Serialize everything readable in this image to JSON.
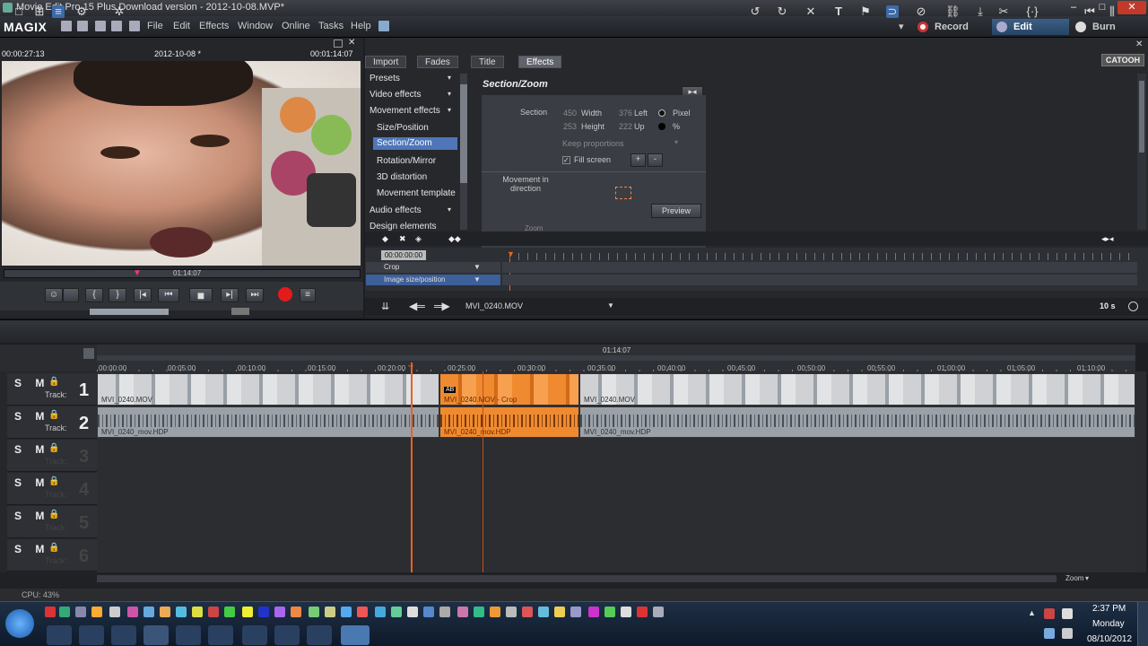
{
  "window": {
    "title": "Movie Edit Pro 15 Plus Download version - 2012-10-08.MVP*",
    "min": "–",
    "max": "□",
    "close": "✕"
  },
  "menubar": {
    "logo": "MAGIX",
    "items": [
      "File",
      "Edit",
      "Effects",
      "Window",
      "Online",
      "Tasks",
      "Help"
    ],
    "modes": [
      "Record",
      "Edit",
      "Burn"
    ]
  },
  "preview": {
    "timecode_left": "00:00:27:13",
    "project": "2012-10-08 *",
    "timecode_right": "00:01:14:07",
    "scrub_time": "01:14:07"
  },
  "effects": {
    "tabs": [
      "Import",
      "Fades",
      "Title",
      "Effects"
    ],
    "brand": "CATOOH",
    "tree": [
      "Presets",
      "Video effects",
      "Movement effects",
      "Size/Position",
      "Section/Zoom",
      "Rotation/Mirror",
      "3D distortion",
      "Movement template",
      "Audio effects",
      "Design elements"
    ],
    "panel_title": "Section/Zoom",
    "section_label": "Section",
    "width_value": "450",
    "width_label": "Width",
    "left_value": "376",
    "left_label": "Left",
    "height_value": "253",
    "height_label": "Height",
    "up_value": "222",
    "up_label": "Up",
    "unit_pixel": "Pixel",
    "unit_percent": "%",
    "keep_proportions": "Keep proportions",
    "fill_screen": "Fill screen",
    "movement_label": "Movement in direction",
    "preview_btn": "Preview",
    "zoom_label": "Zoom"
  },
  "keyframes": {
    "time": "00:00:00:00",
    "tracks": [
      "Crop",
      "Image size/position"
    ]
  },
  "nav": {
    "clip": "MVI_0240.MOV",
    "zoom": "10 s"
  },
  "timeline": {
    "total": "01:14:07",
    "ticks": [
      "00:00:00",
      "00:05:00",
      "00:10:00",
      "00:15:00",
      "00:20:00",
      "00:25:00",
      "00:30:00",
      "00:35:00",
      "00:40:00",
      "00:45:00",
      "00:50:00",
      "00:55:00",
      "01:00:00",
      "01:05:00",
      "01:10:00"
    ],
    "track_label": "Track:",
    "sm": "S M",
    "tracks": [
      "1",
      "2",
      "3",
      "4",
      "5",
      "6"
    ],
    "video_clip": "MVI_0240.MOV",
    "video_clip_sel": "MVI_0240.MOV - Crop",
    "audio_clip": "MVI_0240_mov.HDP",
    "ab": "AB",
    "zoom_label": "Zoom"
  },
  "status": {
    "cpu": "CPU: 43%"
  },
  "taskbar": {
    "time": "2:37 PM",
    "day": "Monday",
    "date": "08/10/2012"
  }
}
